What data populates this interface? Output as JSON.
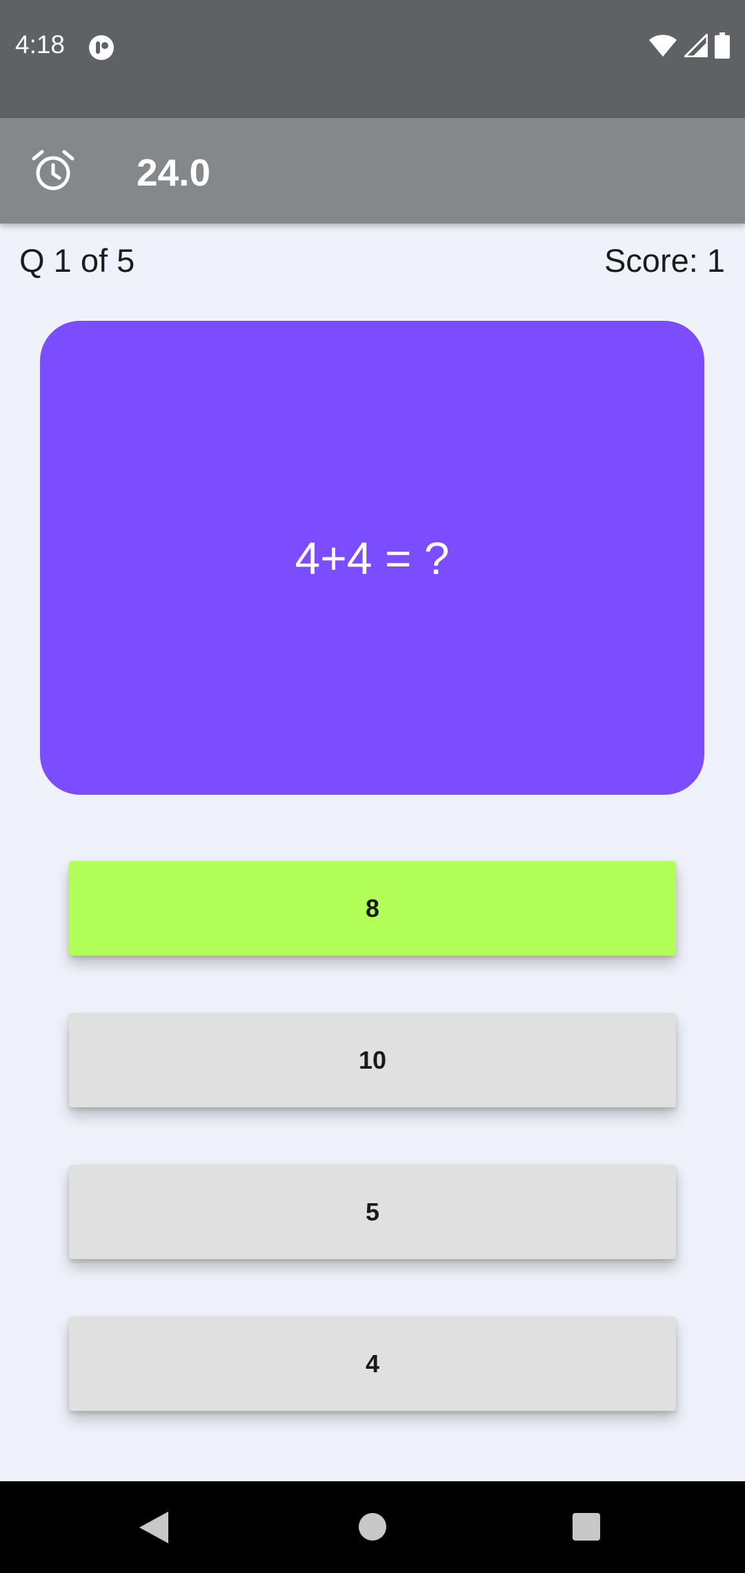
{
  "status_bar": {
    "time": "4:18",
    "icons": [
      "app-notification-icon",
      "wifi-icon",
      "cell-signal-icon",
      "battery-icon"
    ]
  },
  "app_bar": {
    "timer_icon": "alarm-icon",
    "timer_value": "24.0"
  },
  "quiz": {
    "question_counter": "Q 1 of 5",
    "score": "Score: 1",
    "question": "4+4 = ?",
    "answers": [
      {
        "label": "8",
        "state": "correct"
      },
      {
        "label": "10",
        "state": "default"
      },
      {
        "label": "5",
        "state": "default"
      },
      {
        "label": "4",
        "state": "default"
      }
    ]
  },
  "colors": {
    "card": "#7c4dff",
    "correct_answer": "#b2ff59",
    "default_answer": "#e0e0e0",
    "app_bar": "#85888a",
    "status_bar": "#5f6264",
    "background": "#eff2fa"
  },
  "nav_bar": {
    "icons": [
      "back-icon",
      "home-icon",
      "recents-icon"
    ]
  }
}
